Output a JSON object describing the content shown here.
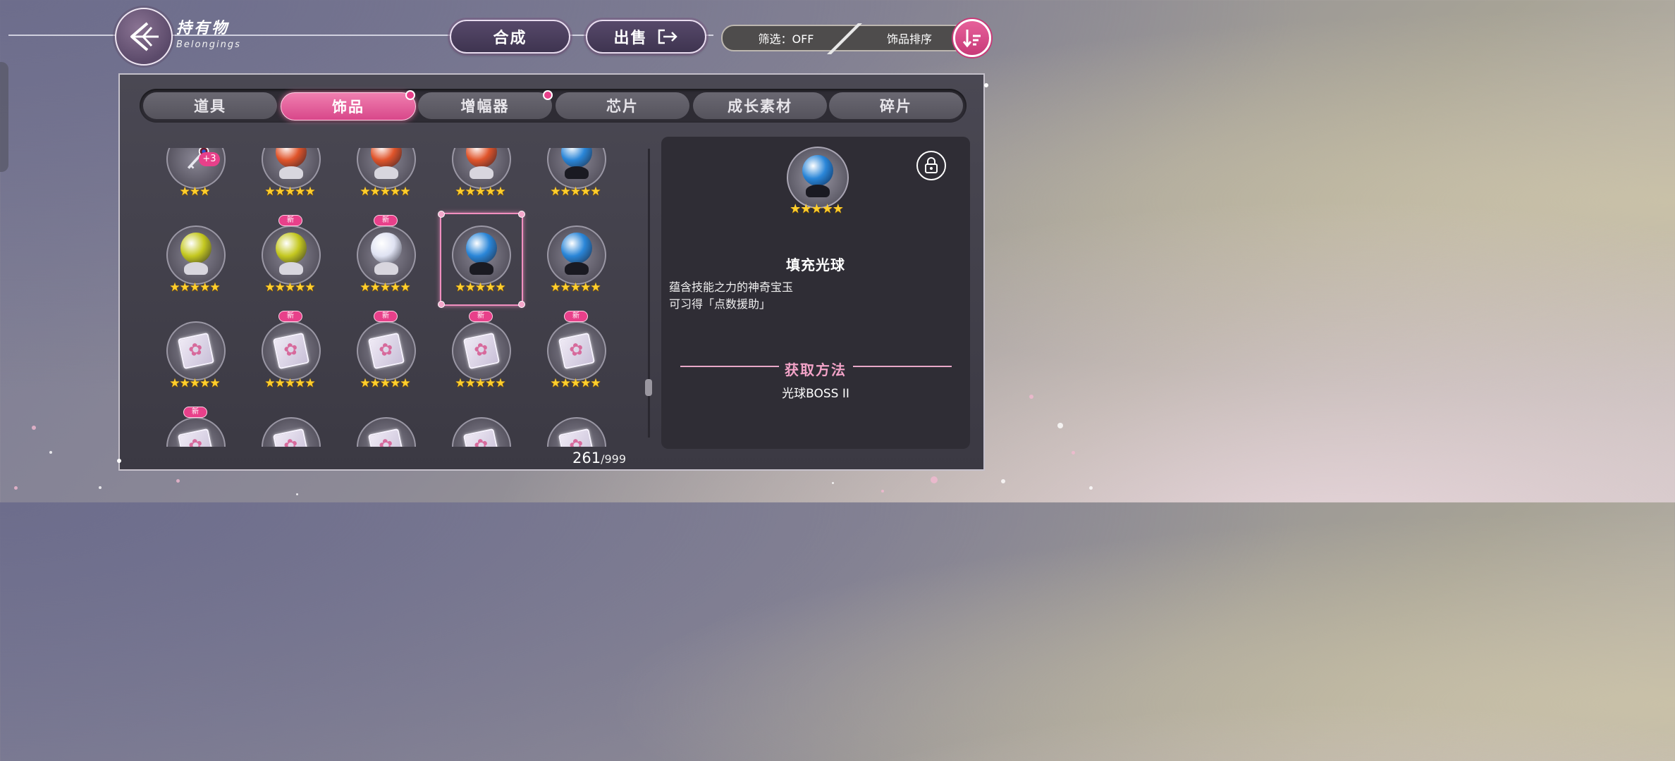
{
  "header": {
    "title_cn": "持有物",
    "title_en": "Belongings",
    "synth_label": "合成",
    "sell_label": "出售",
    "filter_label": "筛选：OFF",
    "sort_label": "饰品排序"
  },
  "tabs": [
    {
      "label": "道具"
    },
    {
      "label": "饰品"
    },
    {
      "label": "增幅器"
    },
    {
      "label": "芯片"
    },
    {
      "label": "成长素材"
    },
    {
      "label": "碎片"
    }
  ],
  "active_tab": "饰品",
  "grid": {
    "rows": [
      [
        {
          "type": "key",
          "stars": "★★★",
          "plus": "+3"
        },
        {
          "type": "orb",
          "color": "#e0542a",
          "stars": "★★★★★"
        },
        {
          "type": "orb",
          "color": "#e0542a",
          "stars": "★★★★★"
        },
        {
          "type": "orb",
          "color": "#e0542a",
          "stars": "★★★★★"
        },
        {
          "type": "orb",
          "color": "#2a86d8",
          "stars": "★★★★★"
        }
      ],
      [
        {
          "type": "orb",
          "color": "#c4c820",
          "stars": "★★★★★"
        },
        {
          "type": "orb",
          "color": "#c4c820",
          "stars": "★★★★★",
          "new": "新"
        },
        {
          "type": "orb",
          "color": "#dfe2f2",
          "stars": "★★★★★",
          "new": "新"
        },
        {
          "type": "orb",
          "color": "#2a86d8",
          "stars": "★★★★★",
          "selected": true
        },
        {
          "type": "orb",
          "color": "#2a86d8",
          "stars": "★★★★★"
        }
      ],
      [
        {
          "type": "chip",
          "stars": "★★★★★"
        },
        {
          "type": "chip",
          "stars": "★★★★★",
          "new": "新"
        },
        {
          "type": "chip",
          "stars": "★★★★★",
          "new": "新"
        },
        {
          "type": "chip",
          "stars": "★★★★★",
          "new": "新"
        },
        {
          "type": "chip",
          "stars": "★★★★★",
          "new": "新"
        }
      ],
      [
        {
          "type": "chip",
          "stars": "",
          "new": "新"
        },
        {
          "type": "chip",
          "stars": ""
        },
        {
          "type": "chip",
          "stars": ""
        },
        {
          "type": "chip",
          "stars": ""
        },
        {
          "type": "chip",
          "stars": ""
        }
      ]
    ]
  },
  "count": {
    "current": "261",
    "max": "/999"
  },
  "detail": {
    "stars": "★★★★★",
    "name": "填充光球",
    "desc_line1": "蕴含技能之力的神奇宝玉",
    "desc_line2": "可习得「点数援助」",
    "obtain_title": "获取方法",
    "obtain_source": "光球BOSS II",
    "orb_color": "#2a86d8"
  },
  "colors": {
    "accent": "#e8408a",
    "star": "#ffcf2d",
    "panel": "#3b3943"
  }
}
